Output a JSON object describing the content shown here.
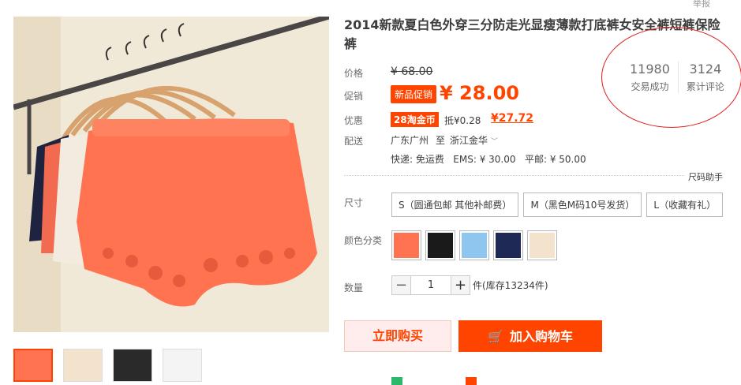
{
  "report": "举报",
  "title": "2014新款夏白色外穿三分防走光显瘦薄款打底裤女安全裤短裤保险裤",
  "price": {
    "label": "价格",
    "original": "¥ 68.00"
  },
  "promo": {
    "label": "促销",
    "badge": "新品促销",
    "price": "¥ 28.00"
  },
  "discount": {
    "label": "优惠",
    "coin_badge": "28淘金币",
    "deduct": "抵¥0.28",
    "coin_price": "¥27.72"
  },
  "shipping": {
    "label": "配送",
    "from": "广东广州",
    "to_word": "至",
    "to": "浙江金华",
    "fees": "快递: 免运费   EMS: ¥ 30.00   平邮: ¥ 50.00"
  },
  "stats": [
    {
      "value": "11980",
      "label": "交易成功"
    },
    {
      "value": "3124",
      "label": "累计评论"
    }
  ],
  "size_helper": "尺码助手",
  "size": {
    "label": "尺寸",
    "options": [
      "S（圆通包邮 其他补邮费）",
      "M（黑色M码10号发货）",
      "L（收藏有礼）"
    ]
  },
  "color": {
    "label": "颜色分类",
    "swatches": [
      "#ff7350",
      "#1a1a1a",
      "#8fc6ef",
      "#1e2a55",
      "#f3e3cc"
    ]
  },
  "quantity": {
    "label": "数量",
    "value": "1",
    "minus": "−",
    "plus": "+",
    "stock": "件(库存13234件)"
  },
  "buttons": {
    "buy_now": "立即购买",
    "add_cart": "加入购物车"
  }
}
